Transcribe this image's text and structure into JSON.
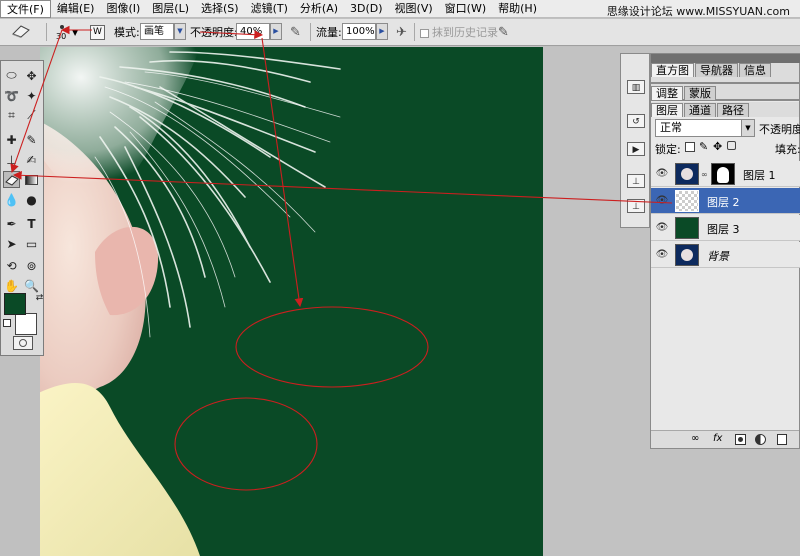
{
  "watermark": "思缘设计论坛 www.MISSYUAN.com",
  "menu": [
    {
      "label": "文件(F)"
    },
    {
      "label": "编辑(E)"
    },
    {
      "label": "图像(I)"
    },
    {
      "label": "图层(L)"
    },
    {
      "label": "选择(S)"
    },
    {
      "label": "滤镜(T)"
    },
    {
      "label": "分析(A)"
    },
    {
      "label": "3D(D)"
    },
    {
      "label": "视图(V)"
    },
    {
      "label": "窗口(W)"
    },
    {
      "label": "帮助(H)"
    }
  ],
  "options": {
    "brush_size": "30",
    "mode_label": "模式:",
    "mode_value": "画笔",
    "opacity_label": "不透明度:",
    "opacity_value": "40%",
    "flow_label": "流量:",
    "flow_value": "100%",
    "erase_history_label": "抹到历史记录"
  },
  "colors": {
    "canvas_bg": "#0a4a26",
    "foreground": "#0a4a26",
    "background": "#ffffff",
    "annotation": "#cc1f1f",
    "selection": "#3b66b4"
  },
  "panels": {
    "top_tabs": [
      "直方图",
      "导航器",
      "信息"
    ],
    "mid_tabs": [
      "调整",
      "蒙版"
    ],
    "layer_tabs": [
      "图层",
      "通道",
      "路径"
    ],
    "blend_mode": "正常",
    "opacity_label": "不透明度:",
    "lock_label": "锁定:",
    "fill_label": "填充:"
  },
  "layers": [
    {
      "name": "图层 1",
      "selected": false,
      "has_mask": true
    },
    {
      "name": "图层 2",
      "selected": true,
      "has_mask": false
    },
    {
      "name": "图层 3",
      "selected": false,
      "has_mask": false
    },
    {
      "name": "背景",
      "selected": false,
      "has_mask": false
    }
  ],
  "icons": {
    "current_tool": "eraser-icon",
    "footer": [
      "link-icon",
      "fx-icon",
      "mask-icon",
      "adjustment-icon",
      "new-layer-icon"
    ]
  }
}
